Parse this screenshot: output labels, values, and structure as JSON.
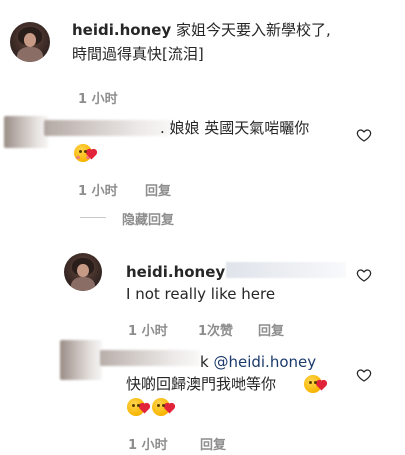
{
  "comments": [
    {
      "username": "heidi.honey",
      "text_line1": "家姐今天要入新學校了,",
      "text_line2": "時間過得真快[流泪]",
      "time": "1 小时"
    },
    {
      "text_partial": ". 娘娘 英國天氣啱曬你",
      "time": "1 小时",
      "reply_label": "回复",
      "hide_replies_label": "隐藏回复"
    },
    {
      "username": "heidi.honey",
      "text": "I not really like here",
      "time": "1 小时",
      "likes": "1次赞",
      "reply_label": "回复"
    },
    {
      "mention_prefix": "k",
      "mention": "@heidi.honey",
      "text_line2": "快啲回歸澳門我哋等你",
      "time": "1 小时",
      "reply_label": "回复"
    }
  ],
  "colors": {
    "text": "#262626",
    "meta": "#8e8e8e",
    "mention": "#1a3a6b"
  }
}
